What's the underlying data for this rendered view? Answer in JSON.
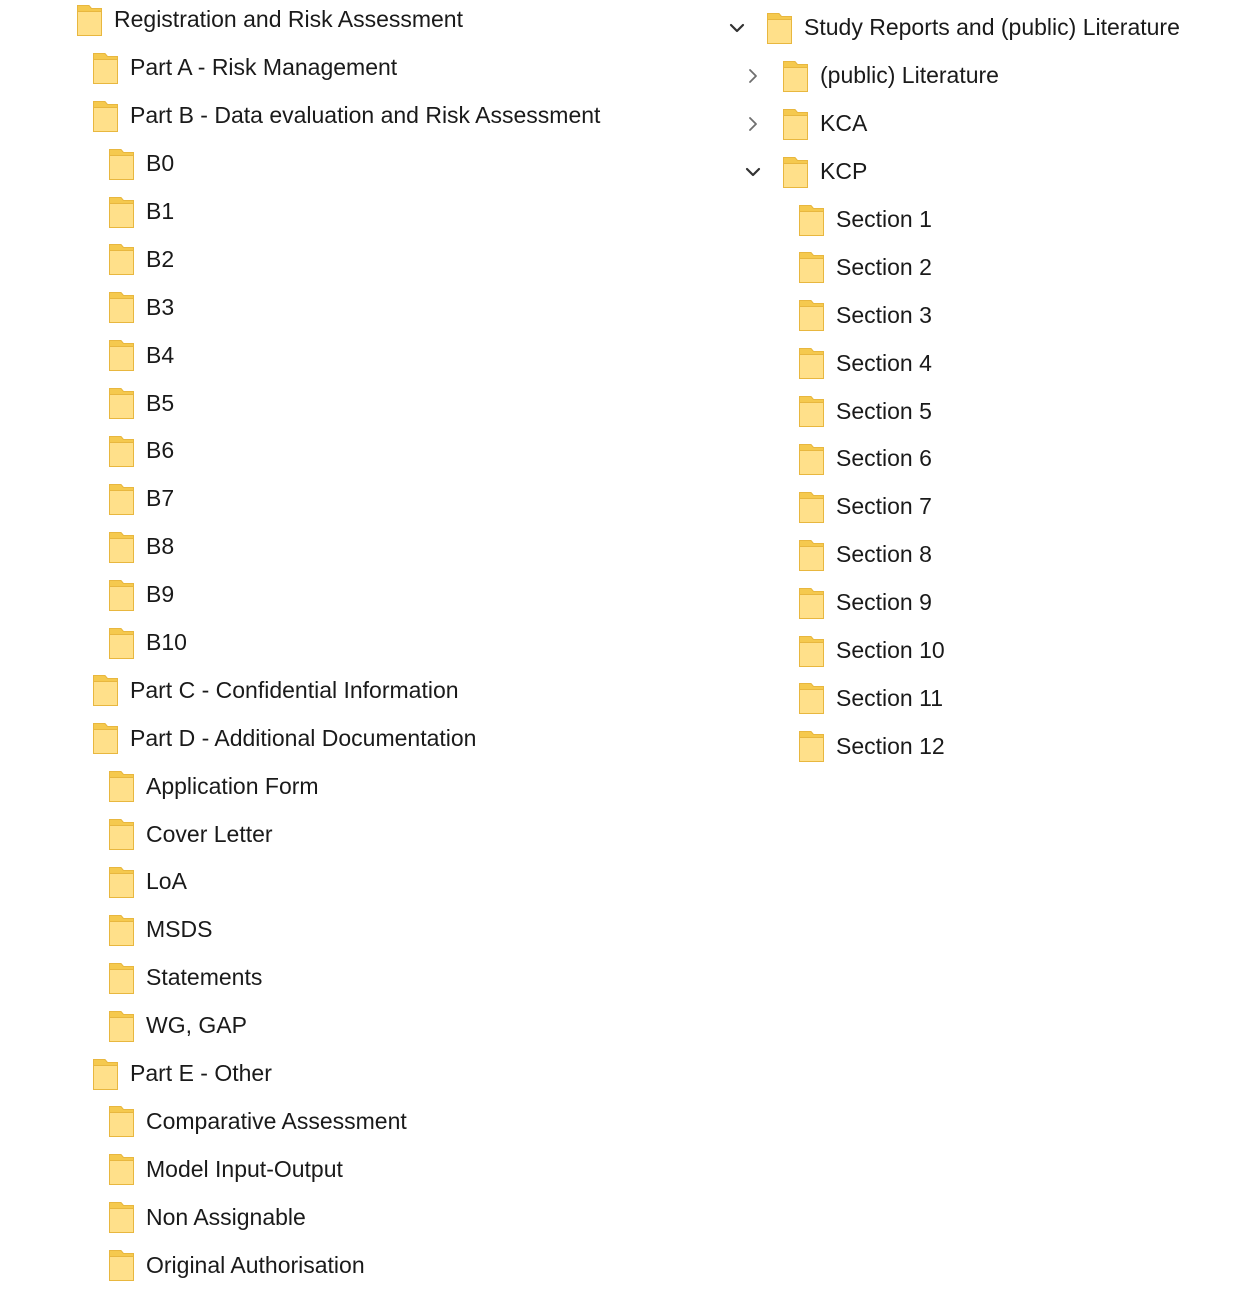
{
  "colors": {
    "folder_fill": "#FFE08A",
    "folder_edge": "#E8B73F",
    "folder_tab": "#F5C94E",
    "chevron": "#6f6f6f",
    "chevron_expanded": "#333333",
    "text": "#1a1a1a"
  },
  "left_tree": [
    {
      "label": "Registration and Risk Assessment",
      "level": 0,
      "icon": "folder-icon"
    },
    {
      "label": "Part A - Risk Management",
      "level": 1,
      "icon": "folder-icon"
    },
    {
      "label": "Part B - Data evaluation and Risk Assessment",
      "level": 1,
      "icon": "folder-icon"
    },
    {
      "label": "B0",
      "level": 2,
      "icon": "folder-icon"
    },
    {
      "label": "B1",
      "level": 2,
      "icon": "folder-icon"
    },
    {
      "label": "B2",
      "level": 2,
      "icon": "folder-icon"
    },
    {
      "label": "B3",
      "level": 2,
      "icon": "folder-icon"
    },
    {
      "label": "B4",
      "level": 2,
      "icon": "folder-icon"
    },
    {
      "label": "B5",
      "level": 2,
      "icon": "folder-icon"
    },
    {
      "label": "B6",
      "level": 2,
      "icon": "folder-icon"
    },
    {
      "label": "B7",
      "level": 2,
      "icon": "folder-icon"
    },
    {
      "label": "B8",
      "level": 2,
      "icon": "folder-icon"
    },
    {
      "label": "B9",
      "level": 2,
      "icon": "folder-icon"
    },
    {
      "label": "B10",
      "level": 2,
      "icon": "folder-icon"
    },
    {
      "label": "Part C - Confidential Information",
      "level": 1,
      "icon": "folder-icon"
    },
    {
      "label": "Part D - Additional Documentation",
      "level": 1,
      "icon": "folder-icon"
    },
    {
      "label": "Application Form",
      "level": 2,
      "icon": "folder-icon"
    },
    {
      "label": "Cover Letter",
      "level": 2,
      "icon": "folder-icon"
    },
    {
      "label": "LoA",
      "level": 2,
      "icon": "folder-icon"
    },
    {
      "label": "MSDS",
      "level": 2,
      "icon": "folder-icon"
    },
    {
      "label": "Statements",
      "level": 2,
      "icon": "folder-icon"
    },
    {
      "label": "WG, GAP",
      "level": 2,
      "icon": "folder-icon"
    },
    {
      "label": "Part E - Other",
      "level": 1,
      "icon": "folder-icon"
    },
    {
      "label": "Comparative Assessment",
      "level": 2,
      "icon": "folder-icon"
    },
    {
      "label": "Model Input-Output",
      "level": 2,
      "icon": "folder-icon"
    },
    {
      "label": "Non Assignable",
      "level": 2,
      "icon": "folder-icon"
    },
    {
      "label": "Original Authorisation",
      "level": 2,
      "icon": "folder-icon"
    }
  ],
  "right_tree": [
    {
      "label": "Study Reports and (public) Literature",
      "level": 0,
      "chevron": "expanded",
      "icon": "folder-icon"
    },
    {
      "label": "(public) Literature",
      "level": 1,
      "chevron": "collapsed",
      "icon": "folder-icon"
    },
    {
      "label": "KCA",
      "level": 1,
      "chevron": "collapsed",
      "icon": "folder-icon"
    },
    {
      "label": "KCP",
      "level": 1,
      "chevron": "expanded",
      "icon": "folder-icon"
    },
    {
      "label": "Section 1",
      "level": 2,
      "chevron": "none",
      "icon": "folder-icon"
    },
    {
      "label": "Section 2",
      "level": 2,
      "chevron": "none",
      "icon": "folder-icon"
    },
    {
      "label": "Section 3",
      "level": 2,
      "chevron": "none",
      "icon": "folder-icon"
    },
    {
      "label": "Section 4",
      "level": 2,
      "chevron": "none",
      "icon": "folder-icon"
    },
    {
      "label": "Section 5",
      "level": 2,
      "chevron": "none",
      "icon": "folder-icon"
    },
    {
      "label": "Section 6",
      "level": 2,
      "chevron": "none",
      "icon": "folder-icon"
    },
    {
      "label": "Section 7",
      "level": 2,
      "chevron": "none",
      "icon": "folder-icon"
    },
    {
      "label": "Section 8",
      "level": 2,
      "chevron": "none",
      "icon": "folder-icon"
    },
    {
      "label": "Section 9",
      "level": 2,
      "chevron": "none",
      "icon": "folder-icon"
    },
    {
      "label": "Section 10",
      "level": 2,
      "chevron": "none",
      "icon": "folder-icon"
    },
    {
      "label": "Section 11",
      "level": 2,
      "chevron": "none",
      "icon": "folder-icon"
    },
    {
      "label": "Section 12",
      "level": 2,
      "chevron": "none",
      "icon": "folder-icon"
    }
  ]
}
